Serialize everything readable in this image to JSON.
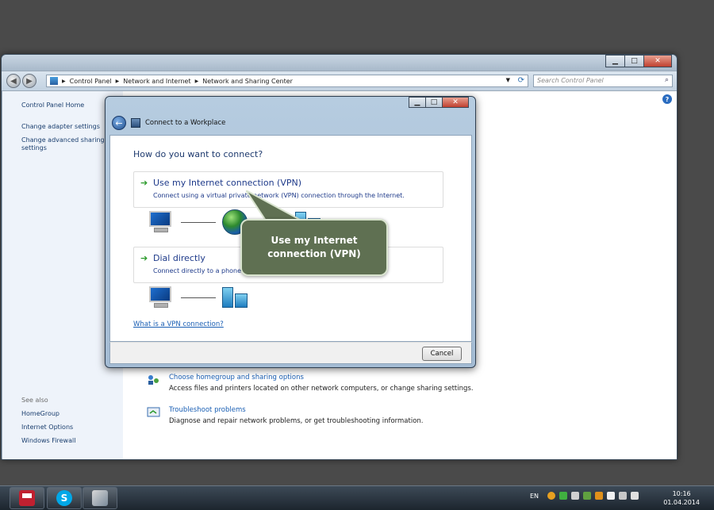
{
  "cp_window": {
    "minimize": "▁",
    "maximize": "□",
    "close": "✕",
    "breadcrumb": [
      "Control Panel",
      "Network and Internet",
      "Network and Sharing Center"
    ],
    "search_placeholder": "Search Control Panel"
  },
  "sidebar": {
    "home": "Control Panel Home",
    "adapter": "Change adapter settings",
    "advanced_1": "Change advanced sharing",
    "advanced_2": "settings",
    "see_also": "See also",
    "homegroup": "HomeGroup",
    "internet_options": "Internet Options",
    "firewall": "Windows Firewall"
  },
  "content": {
    "homegroup_link": "Choose homegroup and sharing options",
    "homegroup_desc": "Access files and printers located on other network computers, or change sharing settings.",
    "troubleshoot_link": "Troubleshoot problems",
    "troubleshoot_desc": "Diagnose and repair network problems, or get troubleshooting information."
  },
  "dialog": {
    "title": "Connect to a Workplace",
    "question": "How do you want to connect?",
    "options": [
      {
        "title": "Use my Internet connection (VPN)",
        "desc": "Connect using a virtual private network (VPN) connection through the Internet."
      },
      {
        "title": "Dial directly",
        "desc": "Connect directly to a phone number without going through the Internet."
      }
    ],
    "vpn_link": "What is a VPN connection?",
    "cancel": "Cancel"
  },
  "callout": {
    "line1": "Use my Internet",
    "line2": "connection (VPN)"
  },
  "taskbar": {
    "lang": "EN",
    "time": "10:16",
    "date": "01.04.2014",
    "skype_letter": "S"
  }
}
